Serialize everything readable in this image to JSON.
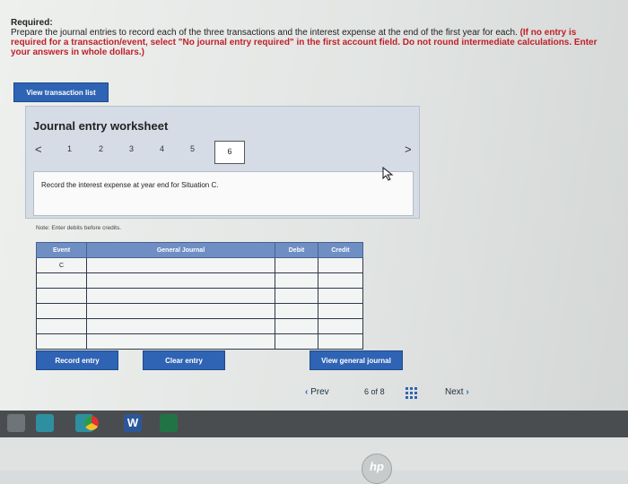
{
  "instructions": {
    "heading": "Required:",
    "text": "Prepare the journal entries to record each of the three transactions and the interest expense at the end of the first year for each.",
    "note": "(If no entry is required for a transaction/event, select \"No journal entry required\" in the first account field. Do not round intermediate calculations. Enter your answers in whole dollars.)"
  },
  "view_transactions_label": "View transaction list",
  "worksheet": {
    "title": "Journal entry worksheet",
    "pages": [
      "1",
      "2",
      "3",
      "4",
      "5",
      "6"
    ],
    "active_page": "6",
    "prev_arrow": "<",
    "next_arrow": ">",
    "description": "Record the interest expense at year end for Situation C.",
    "note": "Note: Enter debits before credits."
  },
  "journal": {
    "headers": {
      "event": "Event",
      "account": "General Journal",
      "debit": "Debit",
      "credit": "Credit"
    },
    "rows": [
      {
        "event": "C",
        "account": "",
        "debit": "",
        "credit": ""
      },
      {
        "event": "",
        "account": "",
        "debit": "",
        "credit": ""
      },
      {
        "event": "",
        "account": "",
        "debit": "",
        "credit": ""
      },
      {
        "event": "",
        "account": "",
        "debit": "",
        "credit": ""
      },
      {
        "event": "",
        "account": "",
        "debit": "",
        "credit": ""
      },
      {
        "event": "",
        "account": "",
        "debit": "",
        "credit": ""
      }
    ]
  },
  "buttons": {
    "record": "Record entry",
    "clear": "Clear entry",
    "view_journal": "View general journal"
  },
  "pagination": {
    "prev": "Prev",
    "current": "6",
    "of": "of",
    "total": "8",
    "next": "Next"
  },
  "taskbar_icon_letter": "W",
  "bezel_logo": "hp",
  "colors": {
    "button_blue": "#2f63b4",
    "header_blue": "#6f8fc4",
    "alert_red": "#c0202a"
  }
}
